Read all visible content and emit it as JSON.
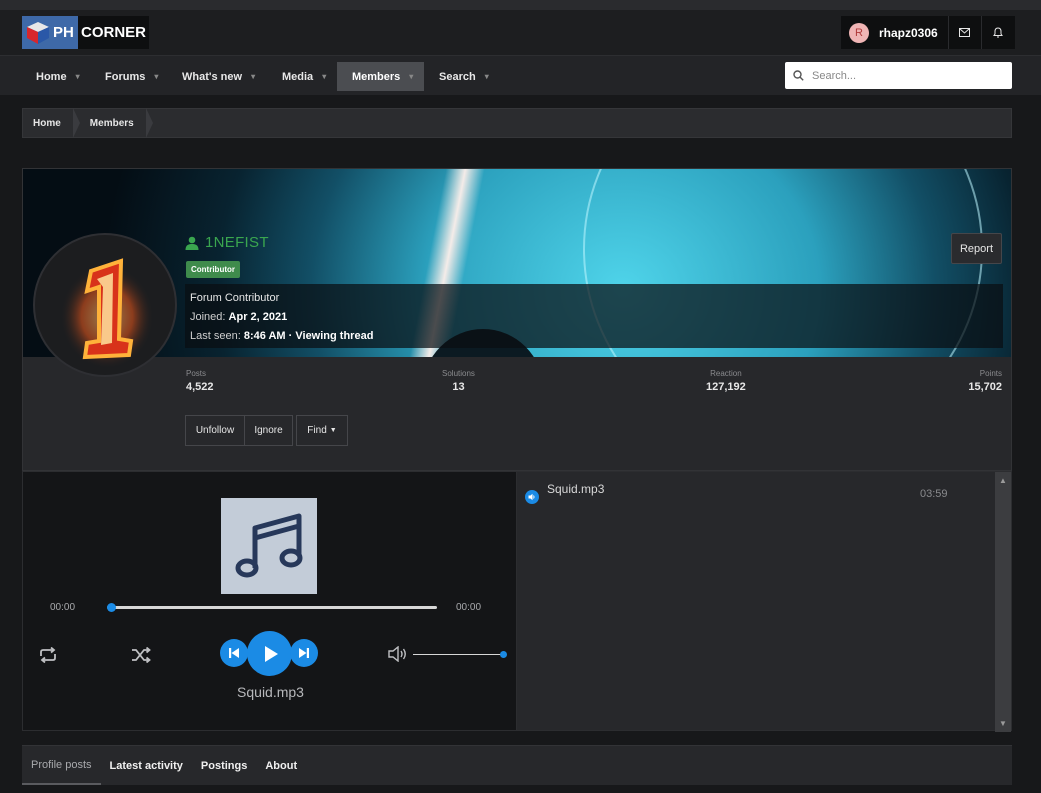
{
  "header": {
    "logo_ph": "PH",
    "logo_corner": "CORNER",
    "user_initial": "R",
    "username": "rhapz0306"
  },
  "nav": {
    "items": [
      {
        "label": "Home",
        "has_caret": true
      },
      {
        "label": "Forums",
        "has_caret": true
      },
      {
        "label": "What's new",
        "has_caret": true
      },
      {
        "label": "Media",
        "has_caret": true
      },
      {
        "label": "Members",
        "has_caret": true,
        "active": true
      },
      {
        "label": "Search",
        "has_caret": true
      }
    ],
    "search_placeholder": "Search..."
  },
  "breadcrumb": [
    "Home",
    "Members"
  ],
  "profile": {
    "name": "1NEFIST",
    "badge": "Contributor",
    "title": "Forum Contributor",
    "joined_label": "Joined:",
    "joined_value": "Apr 2, 2021",
    "last_seen_label": "Last seen:",
    "last_seen_value": "8:46 AM · Viewing thread",
    "report": "Report",
    "stats": [
      {
        "label": "Posts",
        "value": "4,522"
      },
      {
        "label": "Solutions",
        "value": "13"
      },
      {
        "label": "Reaction",
        "value": "127,192"
      },
      {
        "label": "Points",
        "value": "15,702"
      }
    ],
    "buttons": {
      "unfollow": "Unfollow",
      "ignore": "Ignore",
      "find": "Find"
    }
  },
  "player": {
    "current_time": "00:00",
    "total_time": "00:00",
    "progress": 0,
    "volume": 1,
    "track_title": "Squid.mp3"
  },
  "playlist": {
    "items": [
      {
        "name": "Squid.mp3",
        "duration": "03:59"
      }
    ]
  },
  "tabs": [
    {
      "label": "Profile posts",
      "active": true
    },
    {
      "label": "Latest activity"
    },
    {
      "label": "Postings"
    },
    {
      "label": "About"
    }
  ],
  "colors": {
    "accent": "#1b8be5",
    "username": "#3aa64f",
    "badge": "#3f8b4c",
    "nav_active": "#4b4d51"
  }
}
